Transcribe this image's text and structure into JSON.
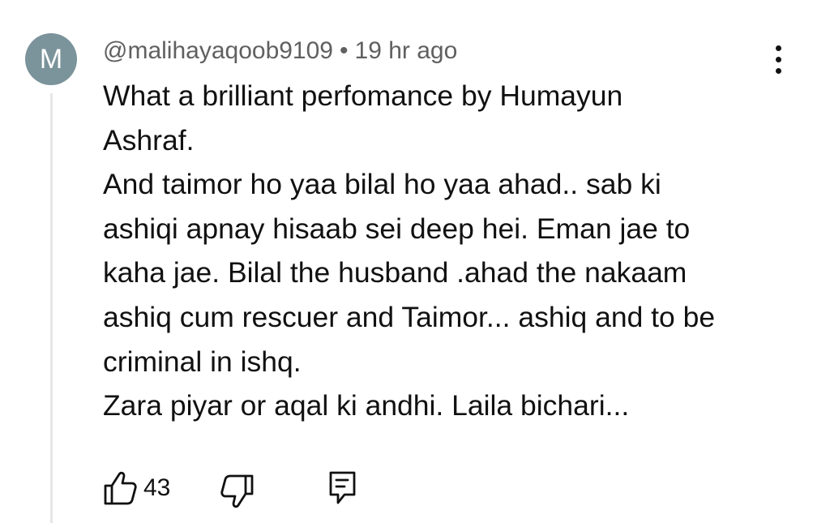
{
  "comment": {
    "avatar_initial": "M",
    "avatar_color": "#7b939a",
    "author": "@malihayaqoob9109",
    "separator": "•",
    "timestamp": "19 hr ago",
    "text_lines": [
      "What a brilliant perfomance by Humayun",
      "Ashraf.",
      "And taimor ho yaa bilal ho yaa ahad.. sab ki",
      "ashiqi apnay hisaab sei deep hei. Eman jae to",
      "kaha jae. Bilal the husband .ahad the nakaam",
      "ashiq cum rescuer and Taimor... ashiq and to be",
      "criminal in ishq.",
      "Zara piyar or aqal ki andhi. Laila bichari..."
    ],
    "like_count": "43"
  },
  "icons": {
    "more": "more-vertical-icon",
    "like": "thumb-up-icon",
    "dislike": "thumb-down-icon",
    "reply": "reply-comment-icon"
  }
}
